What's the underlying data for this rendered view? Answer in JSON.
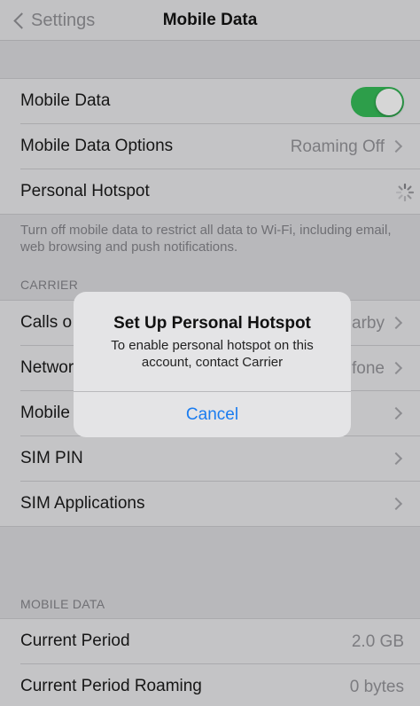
{
  "nav": {
    "back_label": "Settings",
    "title": "Mobile Data"
  },
  "main_group": {
    "mobile_data_label": "Mobile Data",
    "mobile_data_on": true,
    "options_label": "Mobile Data Options",
    "options_value": "Roaming Off",
    "hotspot_label": "Personal Hotspot"
  },
  "footnote": "Turn off mobile data to restrict all data to Wi-Fi, including email, web browsing and push notifications.",
  "carrier": {
    "header": "CARRIER",
    "calls_label": "Calls o",
    "calls_value": "arby",
    "network_label": "Networ",
    "network_value": "fone",
    "mobile_label": "Mobile",
    "sim_pin_label": "SIM PIN",
    "sim_apps_label": "SIM Applications"
  },
  "usage": {
    "header": "MOBILE DATA",
    "current_period_label": "Current Period",
    "current_period_value": "2.0 GB",
    "roaming_label": "Current Period Roaming",
    "roaming_value": "0 bytes"
  },
  "alert": {
    "title": "Set Up Personal Hotspot",
    "message": "To enable personal hotspot on this account, contact Carrier",
    "cancel_label": "Cancel"
  },
  "colors": {
    "toggle_on": "#2d9e4a",
    "link_blue": "#1a7cf0"
  }
}
